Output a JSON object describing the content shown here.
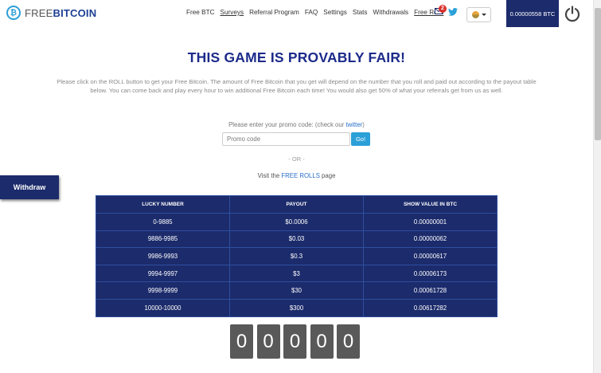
{
  "header": {
    "logo_free": "FREE",
    "logo_bitcoin": "BITCOIN",
    "nav": [
      {
        "label": "Free BTC"
      },
      {
        "label": "Surveys"
      },
      {
        "label": "Referral Program"
      },
      {
        "label": "FAQ"
      },
      {
        "label": "Settings"
      },
      {
        "label": "Stats"
      },
      {
        "label": "Withdrawals"
      },
      {
        "label": "Free Rolls"
      }
    ],
    "mail_count": "2",
    "balance": "0.00000558 BTC"
  },
  "main": {
    "title": "THIS GAME IS PROVABLY FAIR!",
    "description": "Please click on the ROLL button to get your Free Bitcoin. The amount of Free Bitcoin that you get will depend on the number that you roll and paid out according to the payout table below. You can come back and play every hour to win additional Free Bitcoin each time! You would also get 50% of what your referrals get from us as well.",
    "promo_label_prefix": "Please enter your promo code: (check our ",
    "promo_label_link": "twitter",
    "promo_label_suffix": ")",
    "promo_placeholder": "Promo code",
    "go_label": "Go!",
    "or_text": "- OR -",
    "visit_prefix": "Visit the ",
    "visit_link": "FREE ROLLS",
    "visit_suffix": " page",
    "withdraw_label": "Withdraw"
  },
  "payout_table": {
    "headers": [
      "LUCKY NUMBER",
      "PAYOUT",
      "SHOW VALUE IN BTC"
    ],
    "rows": [
      [
        "0-9885",
        "$0.0006",
        "0.00000001"
      ],
      [
        "9886-9985",
        "$0.03",
        "0.00000062"
      ],
      [
        "9986-9993",
        "$0.3",
        "0.00000617"
      ],
      [
        "9994-9997",
        "$3",
        "0.00006173"
      ],
      [
        "9998-9999",
        "$30",
        "0.00061728"
      ],
      [
        "10000-10000",
        "$300",
        "0.00617282"
      ]
    ]
  },
  "digits": [
    "0",
    "0",
    "0",
    "0",
    "0"
  ],
  "icons": {
    "logo": "bitcoin-logo-icon",
    "mail": "mail-icon",
    "twitter": "twitter-icon",
    "language": "flag-icon",
    "power": "power-icon"
  },
  "colors": {
    "navy": "#1c2b6b",
    "title": "#1c2b8a",
    "accent_blue": "#2ba0d8",
    "badge_red": "#d9302c",
    "digit_gray": "#595959"
  }
}
